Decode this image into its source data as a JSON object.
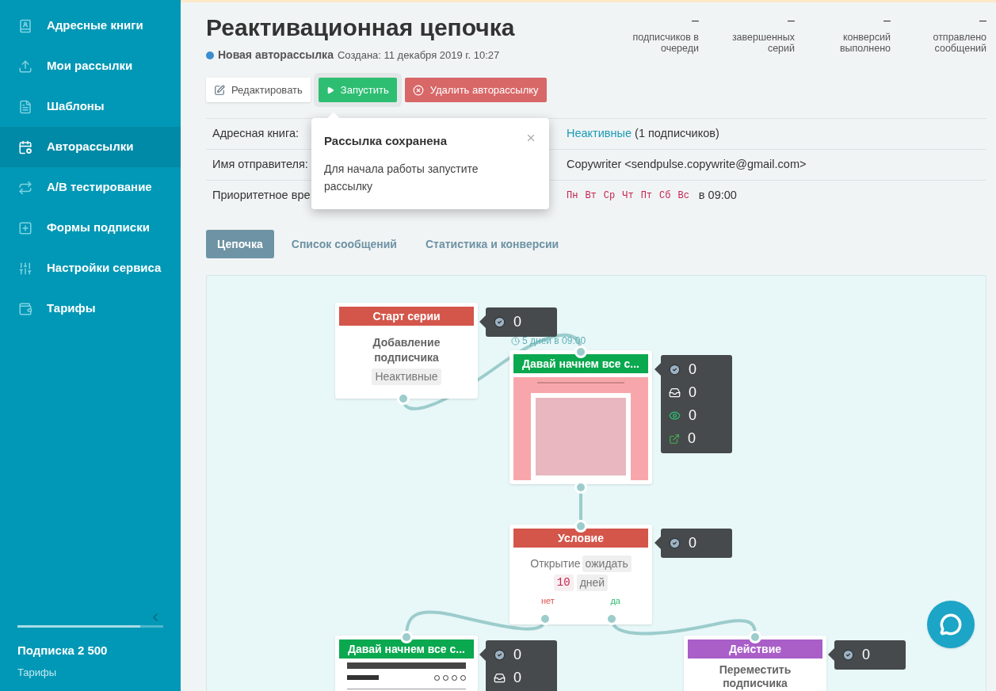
{
  "sidebar": {
    "items": [
      {
        "label": "Адресные книги",
        "selected": false
      },
      {
        "label": "Мои рассылки",
        "selected": false
      },
      {
        "label": "Шаблоны",
        "selected": false
      },
      {
        "label": "Авторассылки",
        "selected": true
      },
      {
        "label": "A/B тестирование",
        "selected": false
      },
      {
        "label": "Формы подписки",
        "selected": false
      },
      {
        "label": "Настройки сервиса",
        "selected": false
      },
      {
        "label": "Тарифы",
        "selected": false
      }
    ],
    "footer": {
      "plan": "Подписка 2 500",
      "link": "Тарифы",
      "level": 0.84
    }
  },
  "header": {
    "title": "Реактивационная цепочка",
    "status": "Новая авторассылка",
    "created": "Создана: 11 декабря 2019 г. 10:27",
    "stats": [
      {
        "value": "–",
        "label": "подписчиков в очереди"
      },
      {
        "value": "–",
        "label": "завершенных серий"
      },
      {
        "value": "–",
        "label": "конверсий выполнено"
      },
      {
        "value": "–",
        "label": "отправлено сообщений"
      }
    ]
  },
  "actions": [
    {
      "kind": "edit",
      "label": "Редактировать"
    },
    {
      "kind": "start",
      "label": "Запустить"
    },
    {
      "kind": "delete",
      "label": "Удалить авторассылку"
    }
  ],
  "popover": {
    "title": "Рассылка сохранена",
    "text": "Для начала работы запустите рассылку"
  },
  "info": [
    {
      "kind": "link",
      "label": "Адресная книга:",
      "link": "Неактивные",
      "value": "(1 подписчиков)"
    },
    {
      "kind": "text",
      "label": "Имя отправителя:",
      "value": "Copywriter <sendpulse.copywrite@gmail.com>"
    },
    {
      "kind": "days",
      "label": "Приоритетное вре",
      "days": [
        "Пн",
        "Вт",
        "Ср",
        "Чт",
        "Пт",
        "Сб",
        "Вс"
      ],
      "value": "в 09:00"
    }
  ],
  "tabs": [
    {
      "label": "Цепочка",
      "selected": true
    },
    {
      "label": "Список сообщений",
      "selected": false
    },
    {
      "label": "Статистика и конверсии",
      "selected": false
    }
  ],
  "flow": {
    "nodes": [
      {
        "kind": "start",
        "title": "Старт серии",
        "text": "Добавление подписчика",
        "tag": "Неактивные",
        "stats": [
          {
            "kind": "delivered",
            "value": "0"
          }
        ]
      },
      {
        "kind": "email",
        "title": "Давай начнем все с...",
        "delay": "5 дней в 09:00",
        "stats": [
          {
            "kind": "delivered",
            "value": "0"
          },
          {
            "kind": "inbox",
            "value": "0"
          },
          {
            "kind": "opened",
            "value": "0"
          },
          {
            "kind": "clicked",
            "value": "0"
          }
        ]
      },
      {
        "kind": "condition",
        "title": "Условие",
        "event": "Открытие",
        "mode": "ожидать",
        "count": "10",
        "unit": "дней",
        "no": "нет",
        "yes": "да",
        "stats": [
          {
            "kind": "delivered",
            "value": "0"
          }
        ]
      },
      {
        "kind": "email",
        "title": "Давай начнем все с...",
        "stats": [
          {
            "kind": "delivered",
            "value": "0"
          },
          {
            "kind": "inbox",
            "value": "0"
          }
        ]
      },
      {
        "kind": "action",
        "title": "Действие",
        "text": "Переместить подписчика",
        "stats": [
          {
            "kind": "delivered",
            "value": "0"
          }
        ]
      }
    ]
  }
}
